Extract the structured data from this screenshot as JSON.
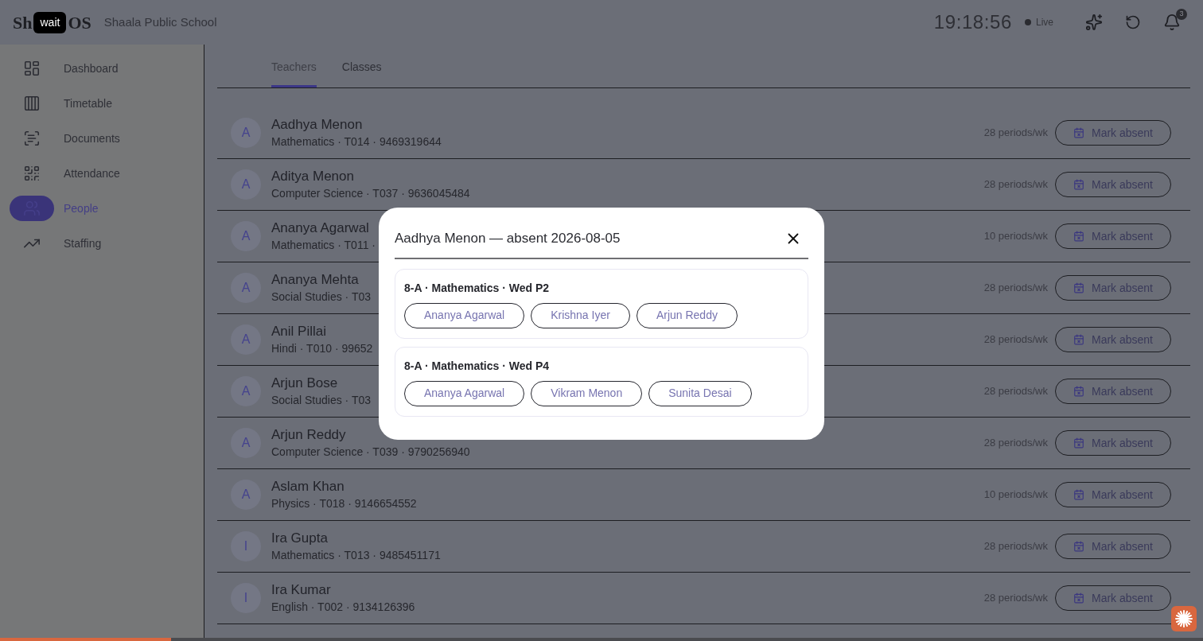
{
  "header": {
    "logo_parts": [
      "Sh",
      "OS"
    ],
    "tooltip": "wait",
    "school": "Shaala Public School",
    "clock": "19:18:56",
    "live": "Live",
    "notification_count": "3"
  },
  "sidebar": {
    "items": [
      {
        "label": "Dashboard",
        "selected": false
      },
      {
        "label": "Timetable",
        "selected": false
      },
      {
        "label": "Documents",
        "selected": false
      },
      {
        "label": "Attendance",
        "selected": false
      },
      {
        "label": "People",
        "selected": true
      },
      {
        "label": "Staffing",
        "selected": false
      }
    ]
  },
  "tabs": [
    {
      "label": "Teachers",
      "selected": true
    },
    {
      "label": "Classes",
      "selected": false
    }
  ],
  "teachers": [
    {
      "initial": "A",
      "name": "Aadhya Menon",
      "details": "Mathematics · T014 · 9469319644",
      "periods": "28 periods/wk",
      "action": "Mark absent"
    },
    {
      "initial": "A",
      "name": "Aditya Menon",
      "details": "Computer Science · T037 · 9636045484",
      "periods": "28 periods/wk",
      "action": "Mark absent"
    },
    {
      "initial": "A",
      "name": "Ananya Agarwal",
      "details": "Mathematics · T011 ·",
      "periods": "10 periods/wk",
      "action": "Mark absent"
    },
    {
      "initial": "A",
      "name": "Ananya Mehta",
      "details": "Social Studies · T03",
      "periods": "28 periods/wk",
      "action": "Mark absent"
    },
    {
      "initial": "A",
      "name": "Anil Pillai",
      "details": "Hindi · T010 · 99652",
      "periods": "28 periods/wk",
      "action": "Mark absent"
    },
    {
      "initial": "A",
      "name": "Arjun Bose",
      "details": "Social Studies · T03",
      "periods": "28 periods/wk",
      "action": "Mark absent"
    },
    {
      "initial": "A",
      "name": "Arjun Reddy",
      "details": "Computer Science · T039 · 9790256940",
      "periods": "28 periods/wk",
      "action": "Mark absent"
    },
    {
      "initial": "A",
      "name": "Aslam Khan",
      "details": "Physics · T018 · 9146654552",
      "periods": "10 periods/wk",
      "action": "Mark absent"
    },
    {
      "initial": "I",
      "name": "Ira Gupta",
      "details": "Mathematics · T013 · 9485451171",
      "periods": "28 periods/wk",
      "action": "Mark absent"
    },
    {
      "initial": "I",
      "name": "Ira Kumar",
      "details": "English · T002 · 9134126396",
      "periods": "28 periods/wk",
      "action": "Mark absent"
    }
  ],
  "dialog": {
    "title": "Aadhya Menon — absent 2026-08-05",
    "slots": [
      {
        "heading": "8-A · Mathematics · Wed P2",
        "substitutes": [
          "Ananya Agarwal",
          "Krishna Iyer",
          "Arjun Reddy"
        ]
      },
      {
        "heading": "8-A · Mathematics · Wed P4",
        "substitutes": [
          "Ananya Agarwal",
          "Vikram Menon",
          "Sunita Desai"
        ]
      }
    ]
  },
  "progress": {
    "level": 0.142
  }
}
